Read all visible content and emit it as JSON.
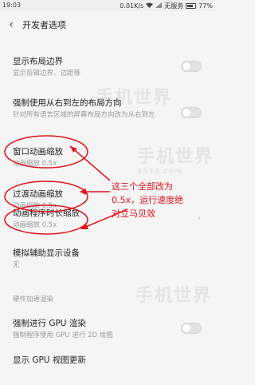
{
  "status_bar": {
    "time": "19:03",
    "speed": "0.01K/s",
    "carrier": "无服务",
    "battery": "77%",
    "battery_level": 0.77
  },
  "header": {
    "back_icon": "chevron-left-icon",
    "title": "开发者选项"
  },
  "rows": [
    {
      "title": "显示布局边界",
      "subtitle": "显示剪辑边界、边距等"
    },
    {
      "title": "强制使用从右到左的布局方向",
      "subtitle": "针对所有语言区域的屏幕布局方向改为从右到左"
    },
    {
      "title": "窗口动画缩放",
      "subtitle": "动画缩放 0.5x"
    },
    {
      "title": "过渡动画缩放",
      "subtitle": "动画缩放 0.5x"
    },
    {
      "title": "动画程序时长缩放",
      "subtitle": "动画缩放 0.5x"
    },
    {
      "title": "模拟辅助显示设备",
      "subtitle": "无"
    },
    {
      "title": "强制进行 GPU 渲染",
      "subtitle": "强制程序使用 GPU 进行 2D 绘图"
    },
    {
      "title": "显示 GPU 视图更新"
    }
  ],
  "section_hardware": "硬件加速渲染",
  "annotation": {
    "line1": "这三个全部改为",
    "line2": "0.5x，运行速度绝",
    "line3": "对立马见效",
    "color": "#e0141e"
  },
  "watermark": {
    "text": "手机世界",
    "site": "3533.com"
  }
}
